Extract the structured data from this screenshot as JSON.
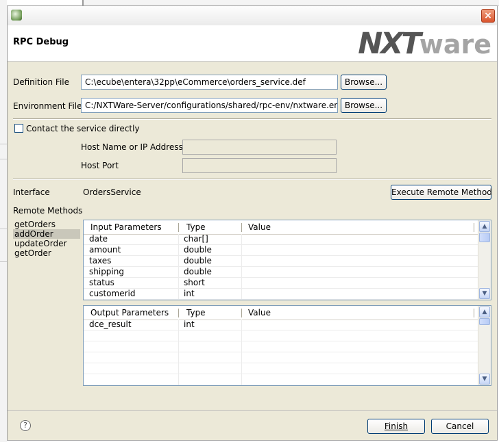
{
  "window": {
    "title": "",
    "close_glyph": "×"
  },
  "header": {
    "title": "RPC Debug",
    "logo": {
      "nx": "NXT",
      "ware": "ware"
    }
  },
  "definition_file": {
    "label": "Definition File",
    "value": "C:\\ecube\\entera\\32pp\\eCommerce\\orders_service.def",
    "browse": "Browse..."
  },
  "environment_file": {
    "label": "Environment File",
    "value": "C:/NXTWare-Server/configurations/shared/rpc-env/nxtware.env",
    "browse": "Browse..."
  },
  "contact": {
    "checkbox_label": "Contact the service directly",
    "checked": false,
    "host_label": "Host Name or IP Address",
    "host_value": "",
    "port_label": "Host Port",
    "port_value": ""
  },
  "interface": {
    "label": "Interface",
    "value": "OrdersService",
    "execute": "Execute Remote Method"
  },
  "remote_methods": {
    "label": "Remote Methods",
    "items": [
      "getOrders",
      "addOrder",
      "updateOrder",
      "getOrder"
    ],
    "selected": "addOrder"
  },
  "input_table": {
    "headers": [
      "Input Parameters",
      "Type",
      "Value"
    ],
    "rows": [
      [
        "date",
        "char[]",
        ""
      ],
      [
        "amount",
        "double",
        ""
      ],
      [
        "taxes",
        "double",
        ""
      ],
      [
        "shipping",
        "double",
        ""
      ],
      [
        "status",
        "short",
        ""
      ],
      [
        "customerid",
        "int",
        ""
      ]
    ]
  },
  "output_table": {
    "headers": [
      "Output Parameters",
      "Type",
      "Value"
    ],
    "rows": [
      [
        "dce_result",
        "int",
        ""
      ]
    ]
  },
  "scroll_glyphs": {
    "up": "▲",
    "down": "▼"
  },
  "footer": {
    "help": "?",
    "finish": "Finish",
    "cancel": "Cancel"
  }
}
